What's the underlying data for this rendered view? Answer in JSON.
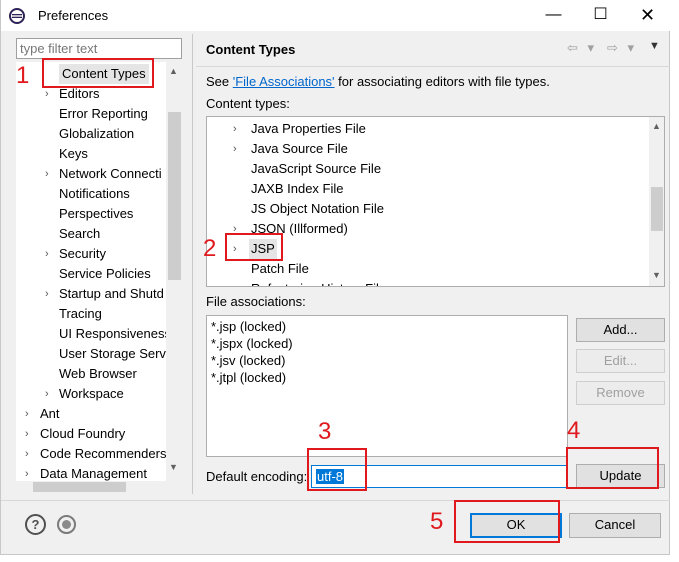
{
  "window": {
    "title": "Preferences",
    "minimize": "—",
    "maximize": "☐",
    "close": "✕"
  },
  "filter": {
    "placeholder": "type filter text"
  },
  "tree": [
    {
      "label": "Content Types",
      "arrow": "",
      "selected": true
    },
    {
      "label": "Editors",
      "arrow": "›"
    },
    {
      "label": "Error Reporting",
      "arrow": ""
    },
    {
      "label": "Globalization",
      "arrow": ""
    },
    {
      "label": "Keys",
      "arrow": ""
    },
    {
      "label": "Network Connecti",
      "arrow": "›"
    },
    {
      "label": "Notifications",
      "arrow": ""
    },
    {
      "label": "Perspectives",
      "arrow": ""
    },
    {
      "label": "Search",
      "arrow": ""
    },
    {
      "label": "Security",
      "arrow": "›"
    },
    {
      "label": "Service Policies",
      "arrow": ""
    },
    {
      "label": "Startup and Shutd",
      "arrow": "›"
    },
    {
      "label": "Tracing",
      "arrow": ""
    },
    {
      "label": "UI Responsiveness",
      "arrow": ""
    },
    {
      "label": "User Storage Serv",
      "arrow": ""
    },
    {
      "label": "Web Browser",
      "arrow": ""
    },
    {
      "label": "Workspace",
      "arrow": "›"
    },
    {
      "label": "Ant",
      "arrow": "›"
    },
    {
      "label": "Cloud Foundry",
      "arrow": "›"
    },
    {
      "label": "Code Recommenders",
      "arrow": "›"
    },
    {
      "label": "Data Management",
      "arrow": "›"
    }
  ],
  "page": {
    "title": "Content Types",
    "see_prefix": "See ",
    "see_link": "'File Associations'",
    "see_suffix": " for associating editors with file types.",
    "content_types_label": "Content types:",
    "file_assoc_label": "File associations:",
    "encoding_label": "Default encoding:",
    "encoding_value": "utf-8"
  },
  "content_types": [
    {
      "label": "Java Properties File",
      "arrow": "›"
    },
    {
      "label": "Java Source File",
      "arrow": "›"
    },
    {
      "label": "JavaScript Source File",
      "arrow": ""
    },
    {
      "label": "JAXB Index File",
      "arrow": ""
    },
    {
      "label": "JS Object Notation File",
      "arrow": ""
    },
    {
      "label": "JSON (Illformed)",
      "arrow": "›"
    },
    {
      "label": "JSP",
      "arrow": "›",
      "selected": true
    },
    {
      "label": "Patch File",
      "arrow": ""
    },
    {
      "label": "Refactoring History File",
      "arrow": ""
    }
  ],
  "file_associations": [
    "*.jsp (locked)",
    "*.jspx (locked)",
    "*.jsv (locked)",
    "*.jtpl (locked)"
  ],
  "buttons": {
    "add": "Add...",
    "edit": "Edit...",
    "remove": "Remove",
    "update": "Update",
    "ok": "OK",
    "cancel": "Cancel"
  },
  "annotations": [
    "1",
    "2",
    "3",
    "4",
    "5"
  ],
  "nav": {
    "back": "⇦ ▾",
    "forward": "⇨ ▾",
    "menu": "▼"
  },
  "colors": {
    "accent": "#0078d7",
    "annotation": "#e0191e",
    "link": "#0066cc"
  }
}
